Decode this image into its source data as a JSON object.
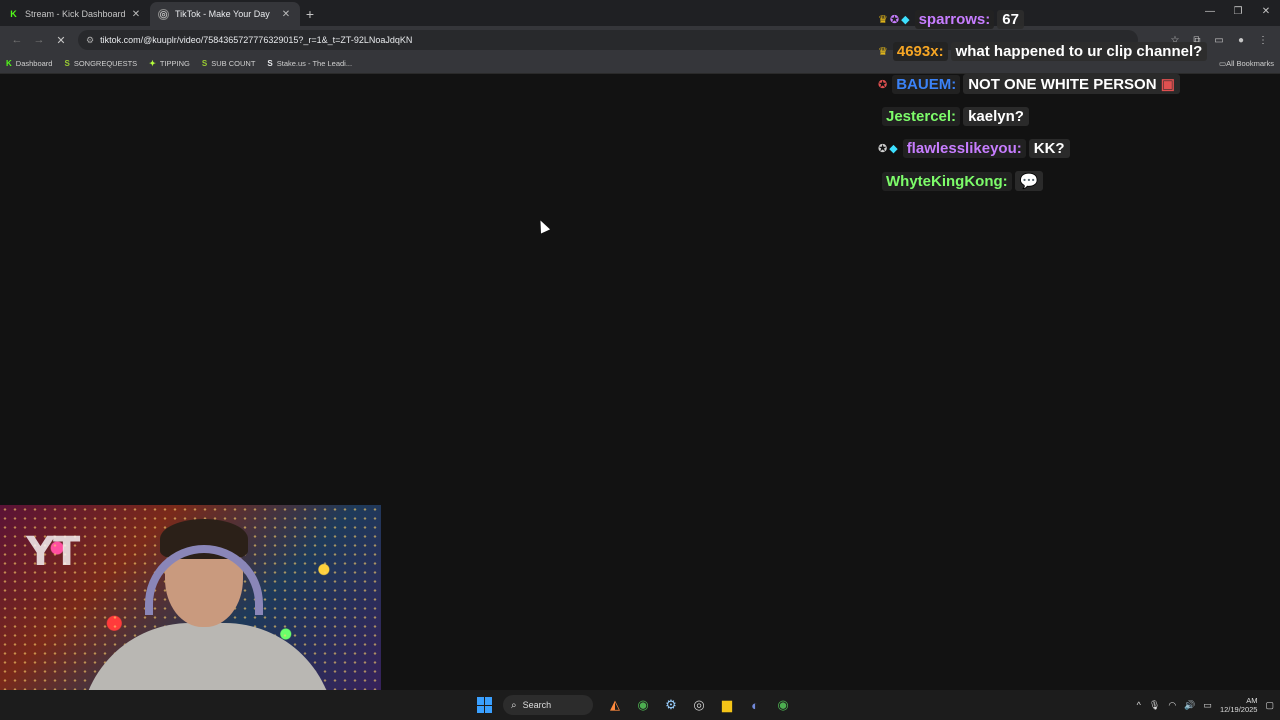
{
  "browser": {
    "tabs": [
      {
        "label": "Stream - Kick Dashboard",
        "favicon": "K"
      },
      {
        "label": "TikTok - Make Your Day",
        "favicon": "◎"
      }
    ],
    "url": "tiktok.com/@kuuplr/video/7584365727776329015?_r=1&_t=ZT-92LNoaJdqKN",
    "bookmarks": [
      {
        "label": "Dashboard",
        "icon": "K"
      },
      {
        "label": "SONGREQUESTS",
        "icon": "S"
      },
      {
        "label": "TIPPING",
        "icon": "✦"
      },
      {
        "label": "SUB COUNT",
        "icon": "S"
      },
      {
        "label": "Stake.us - The Leadi...",
        "icon": "S"
      }
    ],
    "all_bookmarks_label": "All Bookmarks"
  },
  "chat": {
    "messages": [
      {
        "user": "sparrows:",
        "text": "67",
        "color": "#c77dff"
      },
      {
        "user": "4693x:",
        "text": "what happened to ur clip channel?",
        "color": "#f5a524"
      },
      {
        "user": "BAUEM:",
        "text": "NOT ONE WHITE PERSON",
        "color": "#3b82f6"
      },
      {
        "user": "Jestercel:",
        "text": "kaelyn?",
        "color": "#7dfc6a"
      },
      {
        "user": "flawlesslikeyou:",
        "text": "KK?",
        "color": "#c77dff"
      },
      {
        "user": "WhyteKingKong:",
        "text": "",
        "color": "#7dfc6a"
      }
    ]
  },
  "webcam": {
    "overlay_text": "YT"
  },
  "taskbar": {
    "search_label": "Search",
    "time": "AM",
    "date": "12/19/2025"
  }
}
